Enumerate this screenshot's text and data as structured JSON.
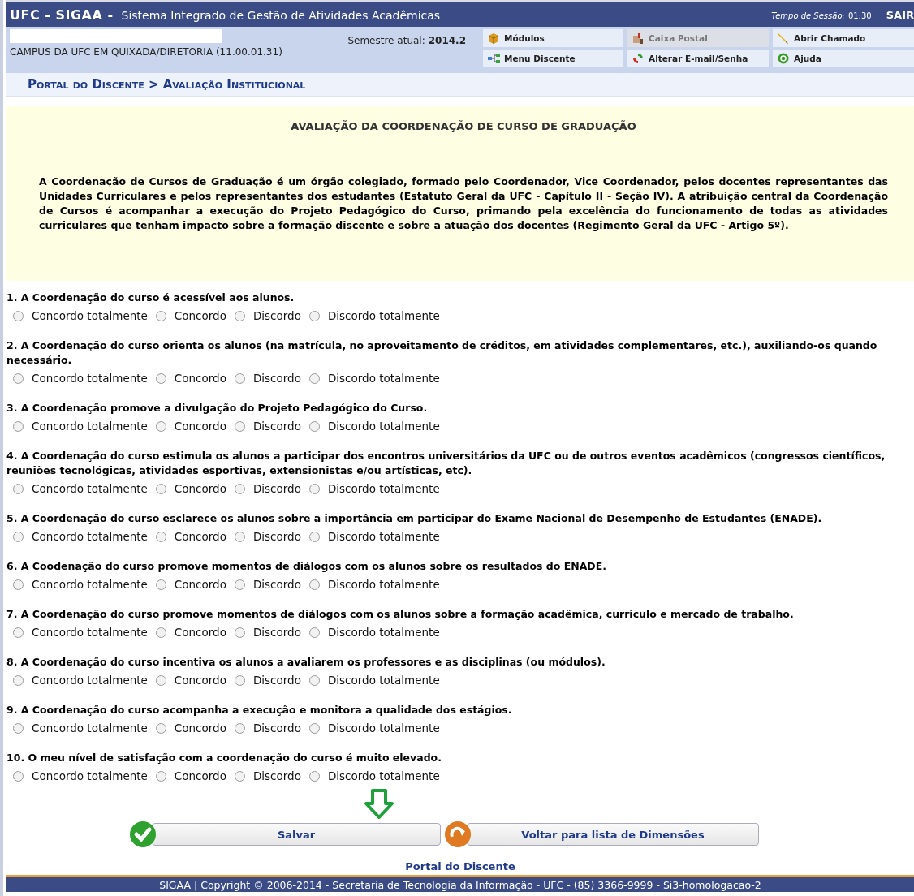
{
  "header": {
    "brand": "UFC - SIGAA -",
    "system_name": "Sistema Integrado de Gestão de Atividades Acadêmicas",
    "session_label": "Tempo de Sessão:",
    "session_time": "01:30",
    "logout": "SAIR"
  },
  "info": {
    "unit": "CAMPUS DA UFC EM QUIXADA/DIRETORIA (11.00.01.31)",
    "semester_label": "Semestre atual:",
    "semester": "2014.2"
  },
  "shortcuts": [
    {
      "label": "Módulos",
      "kind": "box",
      "disabled": false
    },
    {
      "label": "Caixa Postal",
      "kind": "mail",
      "disabled": true
    },
    {
      "label": "Abrir Chamado",
      "kind": "pen",
      "disabled": false
    },
    {
      "label": "Menu Discente",
      "kind": "tree",
      "disabled": false
    },
    {
      "label": "Alterar E-mail/Senha",
      "kind": "refresh",
      "disabled": false
    },
    {
      "label": "Ajuda",
      "kind": "help",
      "disabled": false
    }
  ],
  "breadcrumb": "Portal do Discente > Avaliação Institucional",
  "intro": {
    "title": "AVALIAÇÃO DA COORDENAÇÃO DE CURSO DE GRADUAÇÃO",
    "text": "A Coordenação de Cursos de Graduação é um órgão colegiado, formado pelo Coordenador, Vice Coordenador, pelos docentes representantes das Unidades Curriculares e pelos representantes dos estudantes (Estatuto Geral da UFC - Capítulo II - Seção IV). A atribuição central da Coordenação de Cursos é acompanhar a execução do Projeto Pedagógico do Curso, primando pela excelência do funcionamento de todas as atividades curriculares que tenham impacto sobre a formação discente e sobre a atuação dos docentes (Regimento Geral da UFC - Artigo 5º)."
  },
  "questions": [
    {
      "text": "1. A Coordenação do curso é acessível aos alunos.",
      "options": [
        {
          "label": "Concordo totalmente",
          "selected": false
        },
        {
          "label": "Concordo",
          "selected": false
        },
        {
          "label": "Discordo",
          "selected": false
        },
        {
          "label": "Discordo totalmente",
          "selected": false
        }
      ]
    },
    {
      "text": "2. A Coordenação do curso orienta os alunos (na matrícula, no aproveitamento de créditos, em atividades complementares, etc.), auxiliando-os quando necessário.",
      "options": [
        {
          "label": "Concordo totalmente",
          "selected": false
        },
        {
          "label": "Concordo",
          "selected": false
        },
        {
          "label": "Discordo",
          "selected": false
        },
        {
          "label": "Discordo totalmente",
          "selected": false
        }
      ]
    },
    {
      "text": "3. A Coordenação promove a divulgação do Projeto Pedagógico do Curso.",
      "options": [
        {
          "label": "Concordo totalmente",
          "selected": false
        },
        {
          "label": "Concordo",
          "selected": false
        },
        {
          "label": "Discordo",
          "selected": false
        },
        {
          "label": "Discordo totalmente",
          "selected": false
        }
      ]
    },
    {
      "text": "4. A Coordenação do curso estimula os alunos a participar dos encontros universitários da UFC ou de outros eventos acadêmicos (congressos científicos, reuniões tecnológicas, atividades esportivas, extensionistas e/ou artísticas, etc).",
      "options": [
        {
          "label": "Concordo totalmente",
          "selected": false
        },
        {
          "label": "Concordo",
          "selected": false
        },
        {
          "label": "Discordo",
          "selected": false
        },
        {
          "label": "Discordo totalmente",
          "selected": false
        }
      ]
    },
    {
      "text": "5. A Coordenação do curso esclarece os alunos sobre a importância em participar do Exame Nacional de Desempenho de Estudantes (ENADE).",
      "options": [
        {
          "label": "Concordo totalmente",
          "selected": false
        },
        {
          "label": "Concordo",
          "selected": false
        },
        {
          "label": "Discordo",
          "selected": false
        },
        {
          "label": "Discordo totalmente",
          "selected": false
        }
      ]
    },
    {
      "text": "6. A Coodenação do curso promove momentos de diálogos com os alunos sobre os resultados do ENADE.",
      "options": [
        {
          "label": "Concordo totalmente",
          "selected": false
        },
        {
          "label": "Concordo",
          "selected": false
        },
        {
          "label": "Discordo",
          "selected": false
        },
        {
          "label": "Discordo totalmente",
          "selected": false
        }
      ]
    },
    {
      "text": "7. A Coordenação do curso promove momentos de diálogos com os alunos sobre a formação acadêmica, curriculo e mercado de trabalho.",
      "options": [
        {
          "label": "Concordo totalmente",
          "selected": false
        },
        {
          "label": "Concordo",
          "selected": false
        },
        {
          "label": "Discordo",
          "selected": false
        },
        {
          "label": "Discordo totalmente",
          "selected": false
        }
      ]
    },
    {
      "text": "8. A Coordenação do curso incentiva os alunos a avaliarem os professores e as disciplinas (ou módulos).",
      "options": [
        {
          "label": "Concordo totalmente",
          "selected": false
        },
        {
          "label": "Concordo",
          "selected": false
        },
        {
          "label": "Discordo",
          "selected": false
        },
        {
          "label": "Discordo totalmente",
          "selected": false
        }
      ]
    },
    {
      "text": "9. A Coordenação do curso acompanha a execução e monitora a qualidade dos estágios.",
      "options": [
        {
          "label": "Concordo totalmente",
          "selected": false
        },
        {
          "label": "Concordo",
          "selected": false
        },
        {
          "label": "Discordo",
          "selected": false
        },
        {
          "label": "Discordo totalmente",
          "selected": false
        }
      ]
    },
    {
      "text": "10. O meu nível de satisfação com a coordenação do curso é muito elevado.",
      "options": [
        {
          "label": "Concordo totalmente",
          "selected": false
        },
        {
          "label": "Concordo",
          "selected": false
        },
        {
          "label": "Discordo",
          "selected": false
        },
        {
          "label": "Discordo totalmente",
          "selected": false
        }
      ]
    }
  ],
  "actions": [
    {
      "label": "Salvar",
      "kind": "check"
    },
    {
      "label": "Voltar para lista de Dimensões",
      "kind": "back"
    }
  ],
  "footer_link": "Portal do Discente",
  "footer": "SIGAA | Copyright © 2006-2014 - Secretaria de Tecnologia da Informação - UFC - (85) 3366-9999 - Si3-homologacao-2"
}
